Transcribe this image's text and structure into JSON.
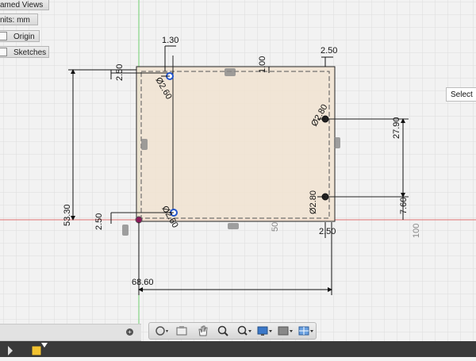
{
  "browser": {
    "items": [
      {
        "label": "amed Views"
      },
      {
        "label": "nits: mm"
      },
      {
        "label": "Origin"
      },
      {
        "label": "Sketches"
      }
    ]
  },
  "tooltip": {
    "text": "Select"
  },
  "dimensions": {
    "top_left_offset": "1.30",
    "left_top_offset": "2.50",
    "hole_top_left_dia": "Ø2.60",
    "top_inner": "1.00",
    "top_right_offset": "2.50",
    "hole_right_top_dia": "Ø2.80",
    "right_vertical": "27.90",
    "hole_right_bottom_dia": "Ø2.80",
    "right_bottom_small": "7.60",
    "left_total_height": "53.30",
    "left_bottom_offset": "2.50",
    "hole_bottom_left_dia": "Ø2.60",
    "bottom_right_offset": "2.50",
    "total_width": "68.60"
  },
  "axis_labels": {
    "x_50": "50",
    "x_100": "100"
  },
  "colors": {
    "sketch_fill": "#f1e3d1",
    "x_axis": "#e07070",
    "y_axis": "#6fcf6f",
    "grid": "#dedede"
  }
}
